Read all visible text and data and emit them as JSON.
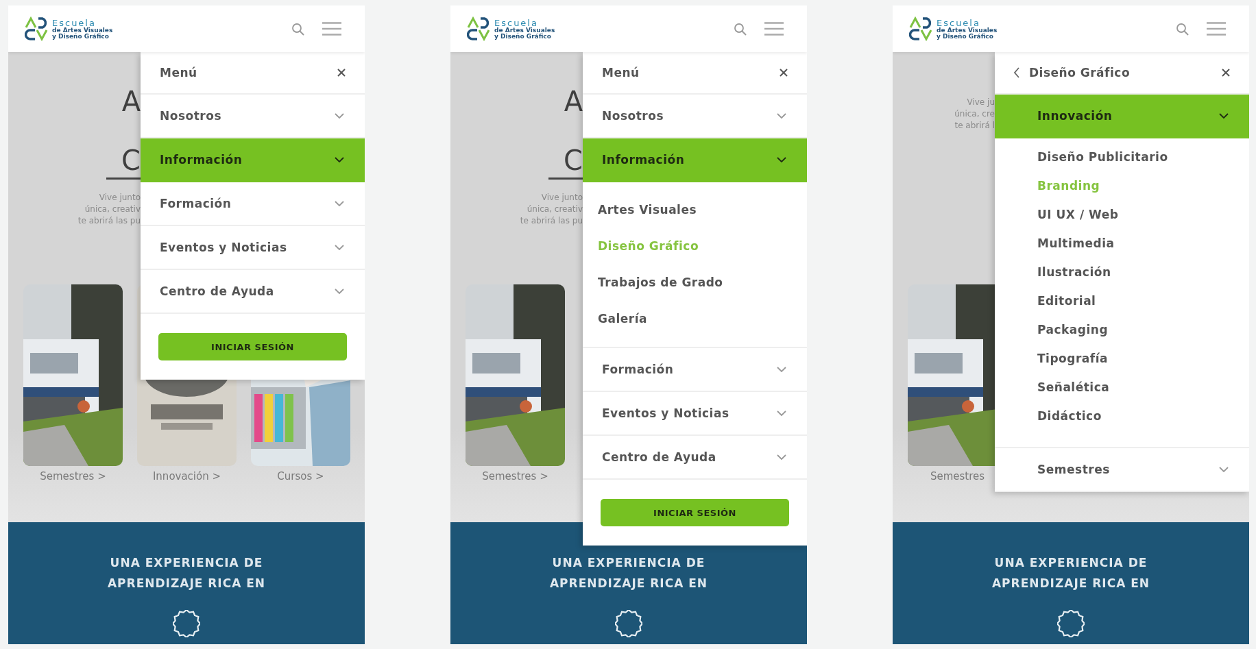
{
  "phones": [
    {
      "header": {
        "school_name": "Escuela",
        "school_lines": [
          "de Artes Visuales",
          "y Diseño Gráfico"
        ]
      },
      "hero": {
        "title_lines": [
          "A",
          "C"
        ],
        "paragraph_lines": [
          "Vive junto",
          "única, creativ",
          "te abrirá las pu"
        ]
      },
      "cards": [
        {
          "label": "Semestres >"
        },
        {
          "label": "Innovación >"
        },
        {
          "label": "Cursos >"
        }
      ],
      "menu": {
        "kind": "main",
        "title": "Menú",
        "items": [
          {
            "label": "Nosotros",
            "selected": false
          },
          {
            "label": "Información",
            "selected": true
          },
          {
            "label": "Formación",
            "selected": false
          },
          {
            "label": "Eventos y Noticias",
            "selected": false
          },
          {
            "label": "Centro de Ayuda",
            "selected": false
          }
        ],
        "button": "INICIAR SESIÓN"
      },
      "banner": {
        "headline_lines": [
          "UNA EXPERIENCIA DE",
          "APRENDIZAJE RICA EN"
        ]
      }
    },
    {
      "header": {
        "school_name": "Escuela",
        "school_lines": [
          "de Artes Visuales",
          "y Diseño Gráfico"
        ]
      },
      "hero": {
        "title_lines": [
          "A",
          "C"
        ],
        "paragraph_lines": [
          "Vive junto",
          "única, creativ",
          "te abrirá las pu"
        ]
      },
      "cards": [
        {
          "label": "Semestres >"
        }
      ],
      "menu": {
        "kind": "main",
        "title": "Menú",
        "items": [
          {
            "label": "Nosotros",
            "selected": false
          },
          {
            "label": "Información",
            "selected": true,
            "children": [
              {
                "label": "Artes Visuales",
                "selected": false
              },
              {
                "label": "Diseño Gráfico",
                "selected": true
              },
              {
                "label": "Trabajos de Grado",
                "selected": false
              },
              {
                "label": "Galería",
                "selected": false
              }
            ]
          },
          {
            "label": "Formación",
            "selected": false
          },
          {
            "label": "Eventos y Noticias",
            "selected": false
          },
          {
            "label": "Centro de Ayuda",
            "selected": false
          }
        ],
        "button": "INICIAR SESIÓN"
      },
      "banner": {
        "headline_lines": [
          "UNA EXPERIENCIA DE",
          "APRENDIZAJE RICA EN"
        ]
      }
    },
    {
      "header": {
        "school_name": "Escuela",
        "school_lines": [
          "de Artes Visuales",
          "y Diseño Gráfico"
        ]
      },
      "hero": {
        "paragraph_lines": [
          "Vive ju",
          "única, cre",
          "te abrirá l"
        ]
      },
      "cards": [
        {
          "label": "Semestres"
        }
      ],
      "menu": {
        "kind": "submenu",
        "title": "Diseño Gráfico",
        "items": [
          {
            "label": "Innovación",
            "selected": true,
            "children": [
              {
                "label": "Diseño Publicitario",
                "selected": false
              },
              {
                "label": "Branding",
                "selected": true
              },
              {
                "label": "UI UX / Web",
                "selected": false
              },
              {
                "label": "Multimedia",
                "selected": false
              },
              {
                "label": "Ilustración",
                "selected": false
              },
              {
                "label": "Editorial",
                "selected": false
              },
              {
                "label": "Packaging",
                "selected": false
              },
              {
                "label": "Tipografía",
                "selected": false
              },
              {
                "label": "Señalética",
                "selected": false
              },
              {
                "label": "Didáctico",
                "selected": false
              }
            ]
          },
          {
            "label": "Semestres",
            "selected": false
          }
        ]
      },
      "banner": {
        "headline_lines": [
          "UNA EXPERIENCIA DE",
          "APRENDIZAJE RICA EN"
        ]
      }
    }
  ]
}
